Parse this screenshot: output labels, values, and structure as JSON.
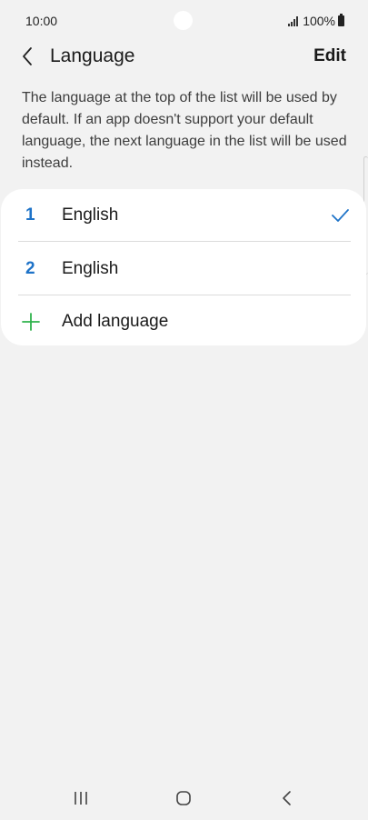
{
  "status_bar": {
    "time": "10:00",
    "battery": "100%"
  },
  "header": {
    "title": "Language",
    "edit_label": "Edit"
  },
  "description": "The language at the top of the list will be used by default. If an app doesn't support your default language, the next language in the list will be used instead.",
  "languages": [
    {
      "index": "1",
      "name": "English",
      "selected": true
    },
    {
      "index": "2",
      "name": "English",
      "selected": false
    }
  ],
  "add_language_label": "Add language",
  "colors": {
    "accent_blue": "#1e73c8",
    "add_green": "#2fb24c",
    "background": "#f2f2f2",
    "card": "#ffffff"
  }
}
